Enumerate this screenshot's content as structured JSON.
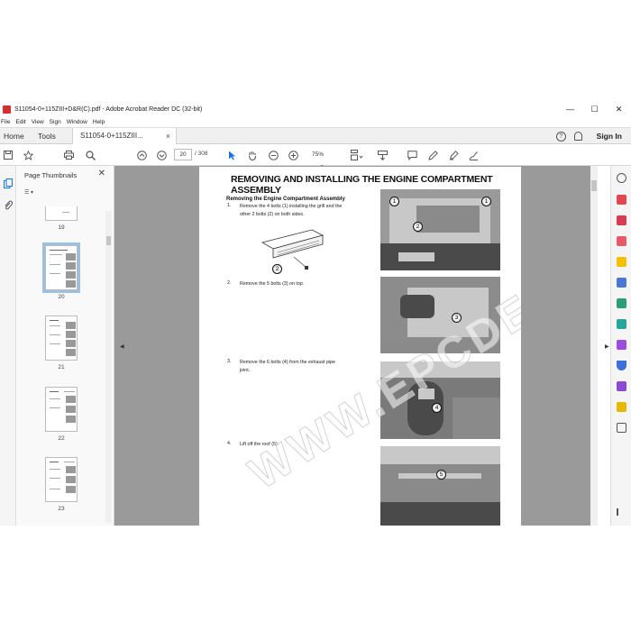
{
  "window": {
    "title": "S11054-0+115ZIII+D&R(C).pdf - Adobe Acrobat Reader DC (32-bit)",
    "minimize": "—",
    "maximize": "☐",
    "close": "✕"
  },
  "menu": [
    "File",
    "Edit",
    "View",
    "Sign",
    "Window",
    "Help"
  ],
  "tabs": {
    "home": "Home",
    "tools": "Tools",
    "document": "S11054-0+115ZIII...",
    "close": "×",
    "help": "?",
    "signin": "Sign In"
  },
  "toolbar": {
    "page_current": "20",
    "page_total": "/ 308",
    "zoom": "75%"
  },
  "thumbnails": {
    "title": "Page Thumbnails",
    "close": "✕",
    "options": "☰ ▾",
    "pages": [
      "19",
      "20",
      "21",
      "22",
      "23"
    ],
    "selected": "20"
  },
  "document": {
    "heading_line1": "REMOVING AND INSTALLING THE ENGINE COMPARTMENT",
    "heading_line2": "ASSEMBLY",
    "subheading": "Removing the Engine Compartment Assembly",
    "steps": [
      {
        "num": "1.",
        "text_line1": "Remove the 4 bolts (1) installing the grill and the",
        "text_line2": "other 2 bolts (2) on both sides."
      },
      {
        "num": "2.",
        "text_line1": "Remove the 5 bolts (3) on top.",
        "text_line2": ""
      },
      {
        "num": "3.",
        "text_line1": "Remove the 6 bolts (4) from the exhaust pipe",
        "text_line2": "joint."
      },
      {
        "num": "4.",
        "text_line1": "Lift off the roof (5).",
        "text_line2": ""
      }
    ],
    "callouts": {
      "c1": "1",
      "c2": "2",
      "c3": "3",
      "c4": "4",
      "c5": "5"
    },
    "watermark": "WWW.EPCDEPOT.COM"
  },
  "colors": {
    "accent": "#1473e6",
    "selected_thumb": "#9cc0e0",
    "doc_background": "#9a9a9a"
  }
}
